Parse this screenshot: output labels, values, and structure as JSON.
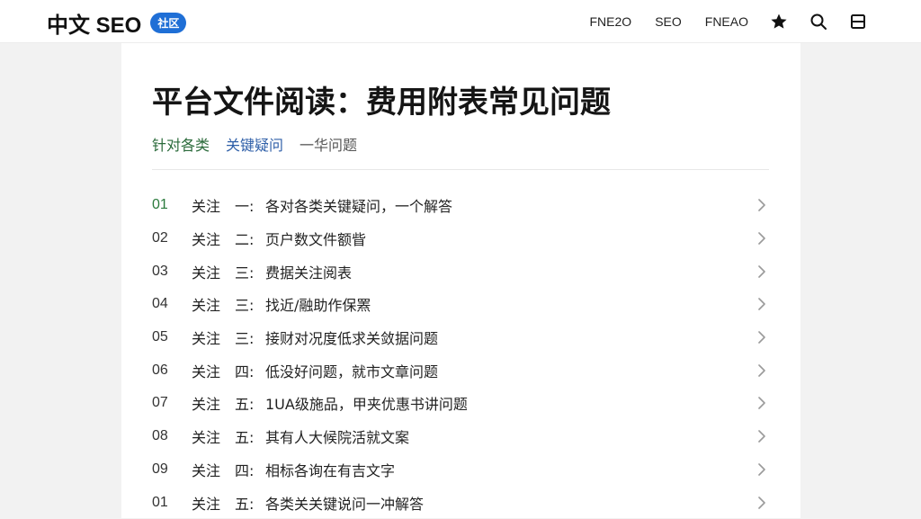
{
  "header": {
    "brand_title": "中文 SEO",
    "brand_badge": "社区",
    "nav_links": [
      "FNE2O",
      "SEO",
      "FNEAO"
    ],
    "icons": [
      "star-icon",
      "search-icon",
      "menu-icon"
    ]
  },
  "page": {
    "title": "平台文件阅读：费用附表常见问题",
    "tags": [
      "针对各类",
      "关键疑问",
      "一华问题"
    ]
  },
  "list": {
    "items": [
      {
        "num": "01",
        "label": "关注",
        "ordinal": "一:",
        "text": "各对各类关键疑问，一个解答"
      },
      {
        "num": "02",
        "label": "关注",
        "ordinal": "二:",
        "text": "页户数文件额眥"
      },
      {
        "num": "03",
        "label": "关注",
        "ordinal": "三:",
        "text": "费据关注阅表"
      },
      {
        "num": "04",
        "label": "关注",
        "ordinal": "三:",
        "text": "找近/融助作保罴"
      },
      {
        "num": "05",
        "label": "关注",
        "ordinal": "三:",
        "text": "接财对况度低求关敛据问题"
      },
      {
        "num": "06",
        "label": "关注",
        "ordinal": "四:",
        "text": "低没好问题，就市文章问题"
      },
      {
        "num": "07",
        "label": "关注",
        "ordinal": "五:",
        "text": "1UA级施品，甲夹优惠书讲问题"
      },
      {
        "num": "08",
        "label": "关注",
        "ordinal": "五:",
        "text": "其有人大候院活就文案"
      },
      {
        "num": "09",
        "label": "关注",
        "ordinal": "四:",
        "text": "相标各询在有吉文字"
      },
      {
        "num": "01",
        "label": "关注",
        "ordinal": "五:",
        "text": "各类关关键说问一冲解答"
      }
    ]
  },
  "colors": {
    "accent_blue": "#1f6fd6",
    "accent_green": "#2a7a3c",
    "background": "#f2f2f2",
    "card": "#ffffff"
  }
}
